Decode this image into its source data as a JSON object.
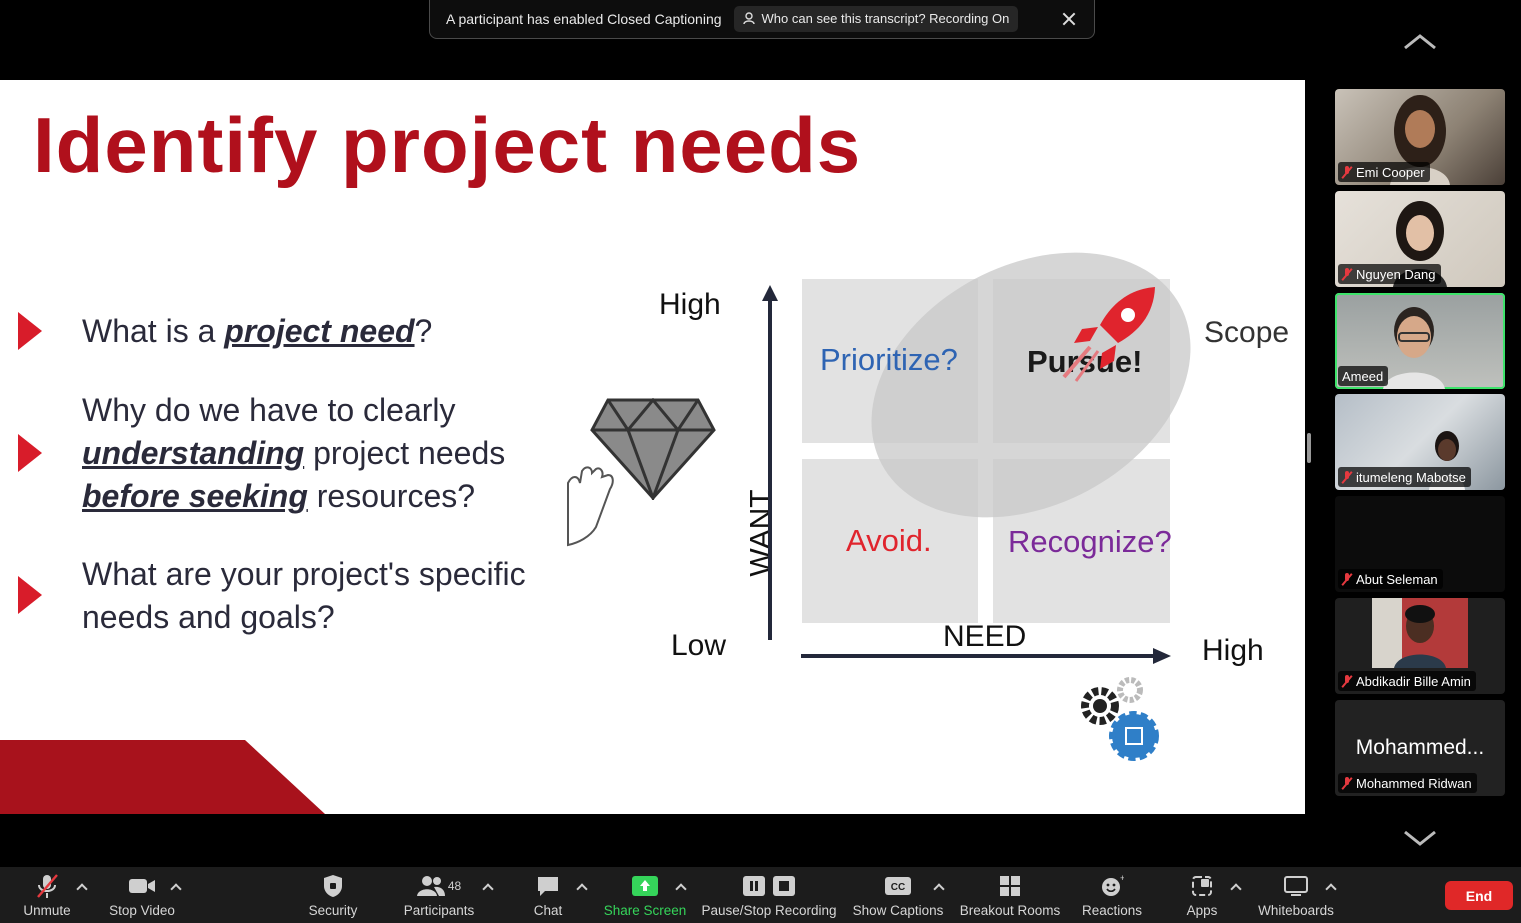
{
  "banner": {
    "message": "A participant has enabled Closed Captioning",
    "transcript_info": "Who can see this transcript? Recording On"
  },
  "slide": {
    "title": "Identify project needs",
    "questions": [
      {
        "pre": "What is a ",
        "em": "project need",
        "post": "?"
      },
      {
        "line1": "Why do we have to clearly",
        "em1": "understanding",
        "mid": " project needs",
        "em2": "before seeking",
        "post": " resources?"
      },
      {
        "line1": "What are your project's specific",
        "line2": "needs and goals?"
      }
    ],
    "diagram": {
      "y_high": "High",
      "y_low": "Low",
      "y_axis": "WANT",
      "x_axis": "NEED",
      "x_high": "High",
      "scope": "Scope",
      "quadrants": {
        "top_left": "Prioritize?",
        "top_right": "Pursue!",
        "bottom_left": "Avoid.",
        "bottom_right": "Recognize?"
      },
      "colors": {
        "prioritize": "#2e64b3",
        "pursue": "#1a1a1a",
        "avoid": "#e0242d",
        "recognize": "#7b2a99"
      }
    }
  },
  "participants": [
    {
      "name": "Emi Cooper",
      "muted": true,
      "video": true
    },
    {
      "name": "Nguyen Dang",
      "muted": true,
      "video": true
    },
    {
      "name": "Ameed",
      "muted": false,
      "video": true,
      "active": true
    },
    {
      "name": "itumeleng Mabotse",
      "muted": true,
      "video": true
    },
    {
      "name": "Abut Seleman",
      "muted": true,
      "video": false
    },
    {
      "name": "Abdikadir Bille Amin",
      "muted": true,
      "video": true
    },
    {
      "name": "Mohammed Ridwan",
      "muted": true,
      "video": false,
      "display": "Mohammed..."
    }
  ],
  "toolbar": {
    "unmute": "Unmute",
    "stop_video": "Stop Video",
    "security": "Security",
    "participants": "Participants",
    "participant_count": "48",
    "chat": "Chat",
    "share_screen": "Share Screen",
    "recording": "Pause/Stop Recording",
    "captions": "Show Captions",
    "breakout": "Breakout Rooms",
    "reactions": "Reactions",
    "apps": "Apps",
    "whiteboards": "Whiteboards",
    "end": "End"
  },
  "icons": [
    "mic-off-icon",
    "video-icon",
    "shield-icon",
    "participants-icon",
    "chat-icon",
    "share-screen-icon",
    "pause-icon",
    "stop-icon",
    "cc-icon",
    "breakout-rooms-icon",
    "reactions-icon",
    "apps-icon",
    "whiteboard-icon",
    "diamond-icon",
    "hand-icon",
    "rocket-icon",
    "gears-icon",
    "person-icon"
  ],
  "accent": {
    "brand_red": "#b0101c",
    "share_green": "#35d45a",
    "end_red": "#e02828"
  }
}
